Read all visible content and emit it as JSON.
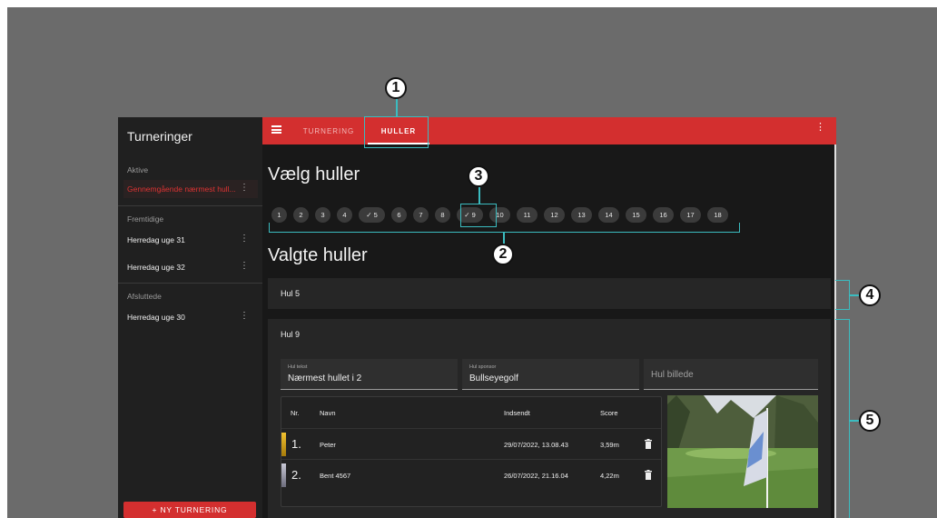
{
  "sidebar": {
    "title": "Turneringer",
    "sections": [
      {
        "label": "Aktive",
        "items": [
          {
            "label": "Gennemgående nærmest hull...",
            "active": true
          }
        ]
      },
      {
        "label": "Fremtidige",
        "items": [
          {
            "label": "Herredag uge 31"
          },
          {
            "label": "Herredag uge 32"
          }
        ]
      },
      {
        "label": "Afsluttede",
        "items": [
          {
            "label": "Herredag uge 30"
          }
        ]
      }
    ],
    "new_button": "+ NY TURNERING"
  },
  "appbar": {
    "tabs": [
      {
        "label": "TURNERING"
      },
      {
        "label": "HULLER",
        "selected": true
      }
    ]
  },
  "main": {
    "select_heading": "Vælg huller",
    "holes": [
      {
        "label": "1"
      },
      {
        "label": "2"
      },
      {
        "label": "3"
      },
      {
        "label": "4"
      },
      {
        "label": "✓ 5",
        "selected": true
      },
      {
        "label": "6"
      },
      {
        "label": "7"
      },
      {
        "label": "8"
      },
      {
        "label": "✓ 9",
        "selected": true
      },
      {
        "label": "10"
      },
      {
        "label": "11"
      },
      {
        "label": "12"
      },
      {
        "label": "13"
      },
      {
        "label": "14"
      },
      {
        "label": "15"
      },
      {
        "label": "16"
      },
      {
        "label": "17"
      },
      {
        "label": "18"
      }
    ],
    "selected_heading": "Valgte huller",
    "hole5_title": "Hul 5",
    "hole9": {
      "title": "Hul 9",
      "fields": {
        "text_label": "Hul tekst",
        "text_value": "Nærmest hullet i 2",
        "sponsor_label": "Hul sponsor",
        "sponsor_value": "Bullseyegolf",
        "image_placeholder": "Hul billede"
      },
      "table": {
        "headers": {
          "nr": "Nr.",
          "name": "Navn",
          "submitted": "Indsendt",
          "score": "Score"
        },
        "rows": [
          {
            "rank": "1.",
            "name": "Peter",
            "submitted": "29/07/2022, 13.08.43",
            "score": "3,59m",
            "color": "#d4a017"
          },
          {
            "rank": "2.",
            "name": "Bent 4567",
            "submitted": "26/07/2022, 21.16.04",
            "score": "4,22m",
            "color": "#9e9eb0"
          }
        ]
      }
    }
  },
  "callouts": {
    "m1": "1",
    "m2": "2",
    "m3": "3",
    "m4": "4",
    "m5": "5"
  },
  "colors": {
    "accent": "#d32f2f",
    "callout": "#3bbcc0"
  }
}
